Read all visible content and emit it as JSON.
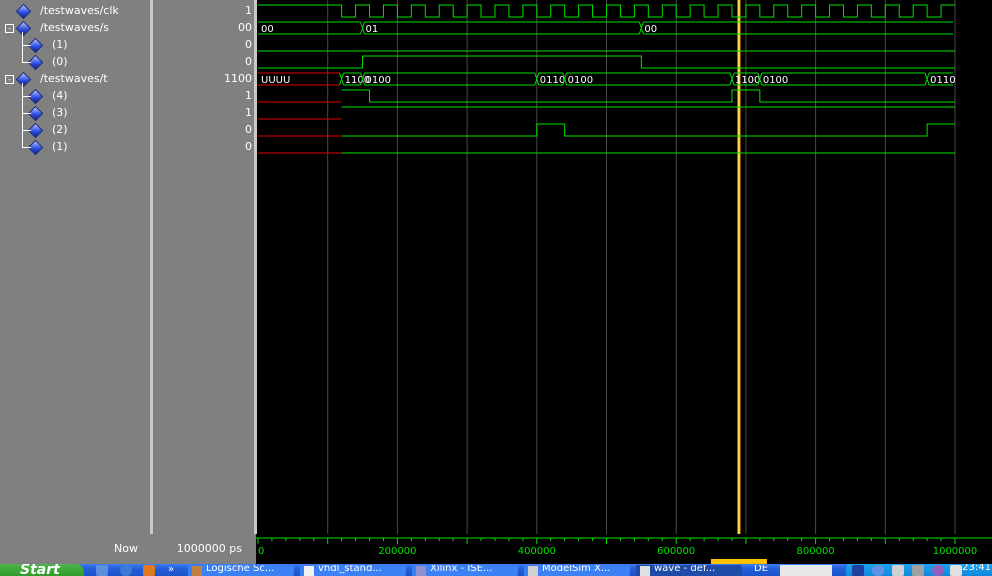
{
  "signals": [
    {
      "name": "/testwaves/clk",
      "value": "1",
      "level": 0,
      "expand": null
    },
    {
      "name": "/testwaves/s",
      "value": "00",
      "level": 0,
      "expand": "-"
    },
    {
      "name": "(1)",
      "value": "0",
      "level": 1,
      "expand": null
    },
    {
      "name": "(0)",
      "value": "0",
      "level": 1,
      "expand": null
    },
    {
      "name": "/testwaves/t",
      "value": "1100",
      "level": 0,
      "expand": "-"
    },
    {
      "name": "(4)",
      "value": "1",
      "level": 1,
      "expand": null
    },
    {
      "name": "(3)",
      "value": "1",
      "level": 1,
      "expand": null
    },
    {
      "name": "(2)",
      "value": "0",
      "level": 1,
      "expand": null
    },
    {
      "name": "(1)",
      "value": "0",
      "level": 1,
      "expand": null
    }
  ],
  "bus_labels": {
    "s": [
      {
        "t": 0,
        "text": "00"
      },
      {
        "t": 150000,
        "text": "01"
      },
      {
        "t": 550000,
        "text": "00"
      }
    ],
    "t": [
      {
        "t": 0,
        "text": "UUUU"
      },
      {
        "t": 120000,
        "text": "1100"
      },
      {
        "t": 150000,
        "text": "0100"
      },
      {
        "t": 400000,
        "text": "0110"
      },
      {
        "t": 440000,
        "text": "0100"
      },
      {
        "t": 680000,
        "text": "1100"
      },
      {
        "t": 720000,
        "text": "0100"
      },
      {
        "t": 960000,
        "text": "0110"
      }
    ]
  },
  "now": {
    "label": "Now",
    "value": "1000000 ps"
  },
  "cursor_time": 690000,
  "time_axis": {
    "start": 0,
    "end": 1000000,
    "major_ticks": [
      0,
      200000,
      400000,
      600000,
      800000,
      1000000
    ],
    "tick_labels": [
      "0",
      "200000",
      "400000",
      "600000",
      "800000",
      "1000000"
    ]
  },
  "colors": {
    "wave": "#00e000",
    "undefined": "#e00000",
    "cursor": "#ffc000",
    "grid": "#4a4a4a"
  },
  "taskbar": {
    "start": "Start",
    "items": [
      "Logische Sc...",
      "vhdl_stand...",
      "Xilinx - ISE...",
      "ModelSim X...",
      "wave - def..."
    ],
    "tray_text": "DE",
    "clock": "23:41"
  }
}
